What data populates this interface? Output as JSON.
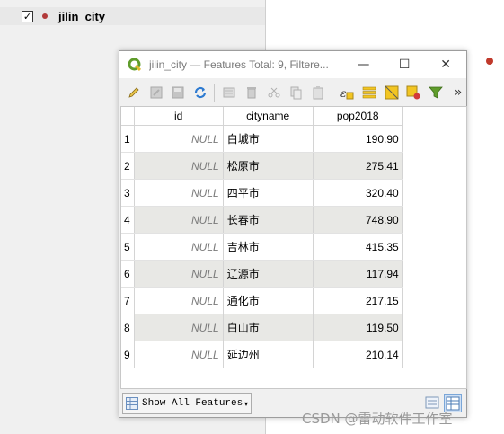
{
  "layers_panel": {
    "layer_name": "jilin_city",
    "checked_mark": "✓"
  },
  "window": {
    "title": "jilin_city — Features Total: 9, Filtere...",
    "minimize": "—",
    "maximize": "☐",
    "close": "✕"
  },
  "toolbar": {
    "overflow": "»",
    "icons": [
      "pencil-icon",
      "multi-edit-icon",
      "save-icon",
      "reload-icon",
      "add-feature-icon",
      "delete-icon",
      "cut-icon",
      "copy-icon",
      "paste-icon",
      "expression-select-icon",
      "select-all-icon",
      "invert-selection-icon",
      "deselect-icon",
      "filter-icon"
    ]
  },
  "table": {
    "columns": [
      "id",
      "cityname",
      "pop2018"
    ],
    "rows": [
      {
        "num": "1",
        "id": "NULL",
        "cityname": "白城市",
        "pop2018": "190.90"
      },
      {
        "num": "2",
        "id": "NULL",
        "cityname": "松原市",
        "pop2018": "275.41"
      },
      {
        "num": "3",
        "id": "NULL",
        "cityname": "四平市",
        "pop2018": "320.40"
      },
      {
        "num": "4",
        "id": "NULL",
        "cityname": "长春市",
        "pop2018": "748.90"
      },
      {
        "num": "5",
        "id": "NULL",
        "cityname": "吉林市",
        "pop2018": "415.35"
      },
      {
        "num": "6",
        "id": "NULL",
        "cityname": "辽源市",
        "pop2018": "117.94"
      },
      {
        "num": "7",
        "id": "NULL",
        "cityname": "通化市",
        "pop2018": "217.15"
      },
      {
        "num": "8",
        "id": "NULL",
        "cityname": "白山市",
        "pop2018": "119.50"
      },
      {
        "num": "9",
        "id": "NULL",
        "cityname": "延边州",
        "pop2018": "210.14"
      }
    ]
  },
  "bottom": {
    "show_features": "Show All Features",
    "caret": "▾"
  },
  "watermark": "CSDN @雷动软件工作室",
  "colors": {
    "layer_dot": "#b23a3a",
    "alt_row": "#e8e8e5",
    "qgis_green": "#5f9c2b"
  }
}
